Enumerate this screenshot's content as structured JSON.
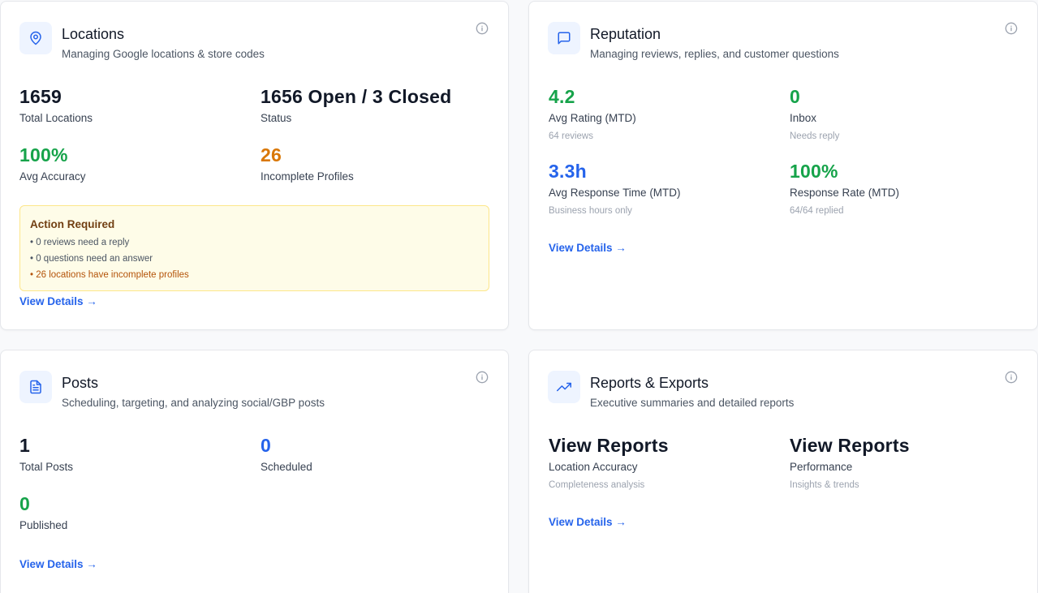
{
  "colors": {
    "accent_blue": "#2563eb",
    "success_green": "#16a34a",
    "warning_orange": "#d97706",
    "alert_bg": "#fefce8",
    "alert_border": "#fde68a"
  },
  "locations": {
    "title": "Locations",
    "subtitle": "Managing Google locations & store codes",
    "icon": "map-pin-icon",
    "stats": [
      {
        "value": "1659",
        "label": "Total Locations"
      },
      {
        "value": "1656 Open / 3 Closed",
        "label": "Status"
      },
      {
        "value": "100%",
        "label": "Avg Accuracy"
      },
      {
        "value": "26",
        "label": "Incomplete Profiles"
      }
    ],
    "alert": {
      "title": "Action Required",
      "items": [
        "• 0 reviews need a reply",
        "• 0 questions need an answer",
        "• 26 locations have incomplete profiles"
      ]
    },
    "link": "View Details →"
  },
  "reputation": {
    "title": "Reputation",
    "subtitle": "Managing reviews, replies, and customer questions",
    "icon": "message-square-icon",
    "stats": [
      {
        "value": "4.2",
        "label": "Avg Rating (MTD)",
        "sub": "64 reviews"
      },
      {
        "value": "0",
        "label": "Inbox",
        "sub": "Needs reply"
      },
      {
        "value": "3.3h",
        "label": "Avg Response Time (MTD)",
        "sub": "Business hours only"
      },
      {
        "value": "100%",
        "label": "Response Rate (MTD)",
        "sub": "64/64 replied"
      }
    ],
    "link": "View Details →"
  },
  "posts": {
    "title": "Posts",
    "subtitle": "Scheduling, targeting, and analyzing social/GBP posts",
    "icon": "file-text-icon",
    "stats": [
      {
        "value": "1",
        "label": "Total Posts"
      },
      {
        "value": "0",
        "label": "Scheduled"
      },
      {
        "value": "0",
        "label": "Published"
      }
    ],
    "link": "View Details →"
  },
  "reports": {
    "title": "Reports & Exports",
    "subtitle": "Executive summaries and detailed reports",
    "icon": "trending-up-icon",
    "stats": [
      {
        "value": "View Reports",
        "label": "Location Accuracy",
        "sub": "Completeness analysis"
      },
      {
        "value": "View Reports",
        "label": "Performance",
        "sub": "Insights & trends"
      }
    ],
    "link": "View Details →"
  }
}
